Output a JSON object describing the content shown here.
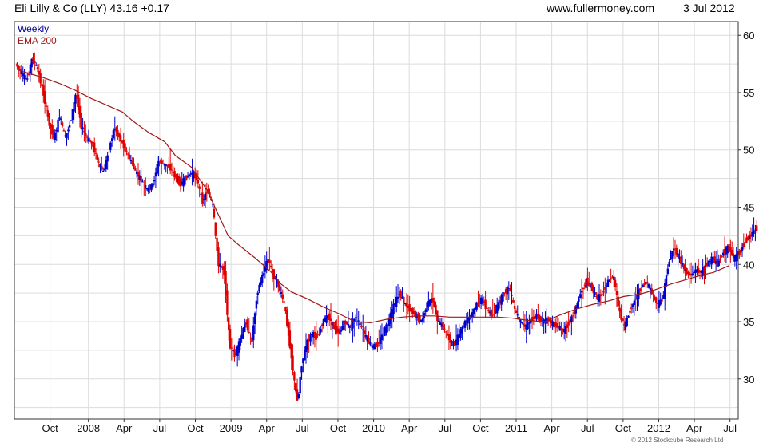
{
  "header": {
    "title": "Eli Lilly & Co (LLY) 43.16 +0.17",
    "site": "www.fullermoney.com",
    "date": "3 Jul 2012"
  },
  "legend": {
    "period": "Weekly",
    "indicator": "EMA 200"
  },
  "copyright": "© 2012 Stockcube Research Ltd",
  "colors": {
    "up": "#0000cc",
    "down": "#e00000",
    "ema": "#a01818",
    "grid": "#dcdcdc",
    "legend_period": "#000099",
    "legend_indicator": "#a01818"
  },
  "chart_data": {
    "type": "line",
    "series": [
      {
        "name": "EMA 200",
        "points": [
          [
            0,
            57.0
          ],
          [
            2,
            56.7
          ],
          [
            5,
            56.3
          ],
          [
            8,
            55.8
          ],
          [
            11,
            55.2
          ],
          [
            14,
            54.5
          ],
          [
            17,
            53.9
          ],
          [
            20,
            53.3
          ],
          [
            22,
            52.5
          ],
          [
            25,
            51.5
          ],
          [
            28,
            50.7
          ],
          [
            30,
            49.5
          ],
          [
            33,
            48.5
          ],
          [
            36,
            46.5
          ],
          [
            38,
            44.5
          ],
          [
            40,
            42.5
          ],
          [
            42,
            41.7
          ],
          [
            45,
            40.6
          ],
          [
            48,
            39.4
          ],
          [
            50,
            38.3
          ],
          [
            52,
            37.6
          ],
          [
            55,
            37.0
          ],
          [
            58,
            36.3
          ],
          [
            61,
            35.7
          ],
          [
            64,
            35.0
          ],
          [
            67,
            34.9
          ],
          [
            70,
            35.2
          ],
          [
            73,
            35.4
          ],
          [
            76,
            35.5
          ],
          [
            79,
            35.5
          ],
          [
            82,
            35.4
          ],
          [
            85,
            35.4
          ],
          [
            88,
            35.4
          ],
          [
            91,
            35.4
          ],
          [
            94,
            35.3
          ],
          [
            97,
            35.1
          ],
          [
            100,
            35.0
          ],
          [
            103,
            35.6
          ],
          [
            106,
            36.1
          ],
          [
            109,
            36.5
          ],
          [
            112,
            36.8
          ],
          [
            115,
            37.2
          ],
          [
            118,
            37.4
          ],
          [
            121,
            37.8
          ],
          [
            124,
            38.3
          ],
          [
            127,
            38.7
          ],
          [
            130,
            39.1
          ],
          [
            132,
            39.3
          ],
          [
            135,
            39.9
          ]
        ]
      }
    ],
    "candles_range": {
      "segments": [
        [
          0,
          57.5
        ],
        [
          2,
          56
        ],
        [
          3,
          58
        ],
        [
          4,
          57
        ],
        [
          5,
          55
        ],
        [
          6,
          52.5
        ],
        [
          7,
          51
        ],
        [
          8,
          53
        ],
        [
          9,
          51
        ],
        [
          10,
          52.5
        ],
        [
          11,
          55
        ],
        [
          12,
          52
        ],
        [
          13,
          51
        ],
        [
          14,
          50.5
        ],
        [
          15,
          49
        ],
        [
          16,
          48
        ],
        [
          17,
          50
        ],
        [
          18,
          52
        ],
        [
          19,
          51
        ],
        [
          20,
          50
        ],
        [
          21,
          49
        ],
        [
          22,
          48
        ],
        [
          24,
          46.5
        ],
        [
          25,
          47
        ],
        [
          26,
          49
        ],
        [
          28,
          48.5
        ],
        [
          30,
          47
        ],
        [
          32,
          48
        ],
        [
          33,
          47.5
        ],
        [
          34,
          45.5
        ],
        [
          35,
          46.5
        ],
        [
          36,
          45
        ],
        [
          36.5,
          42
        ],
        [
          37,
          40
        ],
        [
          38,
          39.5
        ],
        [
          39,
          33
        ],
        [
          40,
          32
        ],
        [
          41,
          33.5
        ],
        [
          42,
          35
        ],
        [
          43,
          33
        ],
        [
          44,
          37.5
        ],
        [
          45,
          39
        ],
        [
          46,
          40.5
        ],
        [
          47,
          39
        ],
        [
          48,
          38
        ],
        [
          49,
          36.5
        ],
        [
          50,
          33
        ],
        [
          51,
          29
        ],
        [
          51.5,
          28
        ],
        [
          52,
          31
        ],
        [
          53,
          33
        ],
        [
          54,
          34
        ],
        [
          55,
          33.5
        ],
        [
          56,
          35
        ],
        [
          57,
          35.5
        ],
        [
          58,
          34.5
        ],
        [
          59,
          34
        ],
        [
          60,
          35
        ],
        [
          61,
          34.5
        ],
        [
          62,
          35.5
        ],
        [
          63,
          34.5
        ],
        [
          64,
          33.5
        ],
        [
          65,
          32.8
        ],
        [
          66,
          33
        ],
        [
          67,
          34
        ],
        [
          68,
          35
        ],
        [
          69,
          36.5
        ],
        [
          70,
          37.5
        ],
        [
          71,
          36.5
        ],
        [
          72,
          36
        ],
        [
          73,
          35.5
        ],
        [
          74,
          35
        ],
        [
          75,
          36.5
        ],
        [
          76,
          37
        ],
        [
          77,
          35
        ],
        [
          78,
          34.5
        ],
        [
          79,
          33.5
        ],
        [
          80,
          33
        ],
        [
          81,
          34
        ],
        [
          82,
          35
        ],
        [
          83,
          35.5
        ],
        [
          84,
          36.5
        ],
        [
          85,
          37
        ],
        [
          86,
          36
        ],
        [
          87,
          35.5
        ],
        [
          88,
          36.5
        ],
        [
          89,
          37.5
        ],
        [
          90,
          38
        ],
        [
          91,
          36
        ],
        [
          92,
          35
        ],
        [
          93,
          34.5
        ],
        [
          94,
          35.2
        ],
        [
          95,
          35.5
        ],
        [
          96,
          35
        ],
        [
          97,
          35.2
        ],
        [
          98,
          34.8
        ],
        [
          99,
          34.5
        ],
        [
          100,
          34.2
        ],
        [
          101,
          35
        ],
        [
          102,
          36
        ],
        [
          103,
          37.5
        ],
        [
          104,
          38.5
        ],
        [
          105,
          38
        ],
        [
          106,
          37
        ],
        [
          107,
          37.5
        ],
        [
          108,
          38.5
        ],
        [
          109,
          39
        ],
        [
          110,
          36
        ],
        [
          111,
          34.5
        ],
        [
          112,
          36
        ],
        [
          113,
          37
        ],
        [
          114,
          38
        ],
        [
          115,
          38.5
        ],
        [
          116,
          37.5
        ],
        [
          117,
          36.5
        ],
        [
          118,
          37
        ],
        [
          119,
          40
        ],
        [
          120,
          41.5
        ],
        [
          121,
          40.5
        ],
        [
          122,
          39.5
        ],
        [
          123,
          39
        ],
        [
          124,
          39.5
        ],
        [
          125,
          39.3
        ],
        [
          126,
          40
        ],
        [
          127,
          40.5
        ],
        [
          128,
          40
        ],
        [
          129,
          41
        ],
        [
          130,
          41.5
        ],
        [
          131,
          40.5
        ],
        [
          132,
          41
        ],
        [
          133,
          42
        ],
        [
          134,
          42.5
        ],
        [
          135,
          43.16
        ]
      ]
    },
    "x_ticks": [
      {
        "label": "Oct",
        "x": 6
      },
      {
        "label": "2008",
        "x": 13
      },
      {
        "label": "Apr",
        "x": 19.5
      },
      {
        "label": "Jul",
        "x": 26
      },
      {
        "label": "Oct",
        "x": 32.5
      },
      {
        "label": "2009",
        "x": 39
      },
      {
        "label": "Apr",
        "x": 45.5
      },
      {
        "label": "Jul",
        "x": 52
      },
      {
        "label": "Oct",
        "x": 58.5
      },
      {
        "label": "2010",
        "x": 65
      },
      {
        "label": "Apr",
        "x": 71.5
      },
      {
        "label": "Jul",
        "x": 78
      },
      {
        "label": "Oct",
        "x": 84.5
      },
      {
        "label": "2011",
        "x": 91
      },
      {
        "label": "Apr",
        "x": 97.5
      },
      {
        "label": "Jul",
        "x": 104
      },
      {
        "label": "Oct",
        "x": 110.5
      },
      {
        "label": "2012",
        "x": 117
      },
      {
        "label": "Apr",
        "x": 123.5
      },
      {
        "label": "Jul",
        "x": 130
      }
    ],
    "y_ticks": [
      30,
      35,
      40,
      45,
      50,
      55,
      60
    ],
    "ylim": [
      26.5,
      61.2
    ],
    "xlim": [
      -0.5,
      131.5
    ],
    "grid": true
  }
}
